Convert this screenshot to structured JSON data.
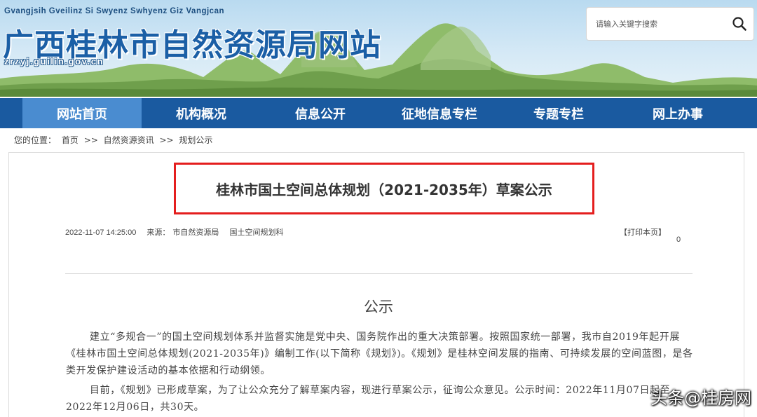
{
  "header": {
    "romanized_name": "Gvangjsih Gveilinz Si Swyenz Swhyenz Giz Vangjcan",
    "site_title": "广西桂林市自然资源局网站",
    "domain": "zrzyj.guilin.gov.cn",
    "search": {
      "placeholder": "请输入关键字搜索",
      "icon": "search-icon"
    }
  },
  "nav": {
    "items": [
      {
        "label": "网站首页",
        "active": true
      },
      {
        "label": "机构概况",
        "active": false
      },
      {
        "label": "信息公开",
        "active": false
      },
      {
        "label": "征地信息专栏",
        "active": false
      },
      {
        "label": "专题专栏",
        "active": false
      },
      {
        "label": "网上办事",
        "active": false
      }
    ]
  },
  "breadcrumb": {
    "prefix": "您的位置：",
    "items": [
      "首页",
      "自然资源资讯",
      "规划公示"
    ],
    "separator": ">>"
  },
  "article": {
    "title": "桂林市国土空间总体规划（2021-2035年）草案公示",
    "date": "2022-11-07 14:25:00",
    "source_label": "来源：",
    "source": "市自然资源局",
    "department": "国土空间规划科",
    "print_label": "【打印本页】",
    "view_count": "0",
    "heading": "公示",
    "paragraphs": [
      "建立“多规合一”的国土空间规划体系并监督实施是党中央、国务院作出的重大决策部署。按照国家统一部署，我市自2019年起开展《桂林市国土空间总体规划(2021-2035年)》编制工作(以下简称《规划》)。《规划》是桂林空间发展的指南、可持续发展的空间蓝图，是各类开发保护建设活动的基本依据和行动纲领。",
      "目前，《规划》已形成草案，为了让公众充分了解草案内容，现进行草案公示，征询公众意见。公示时间：2022年11月07日起至2022年12月06日，共30天。"
    ]
  },
  "watermark": "头条@桂房网",
  "colors": {
    "nav_background": "#1a5aa0",
    "nav_active": "#4a8cd0",
    "title_frame": "#e41e1e",
    "site_title": "#1b5fa6"
  }
}
